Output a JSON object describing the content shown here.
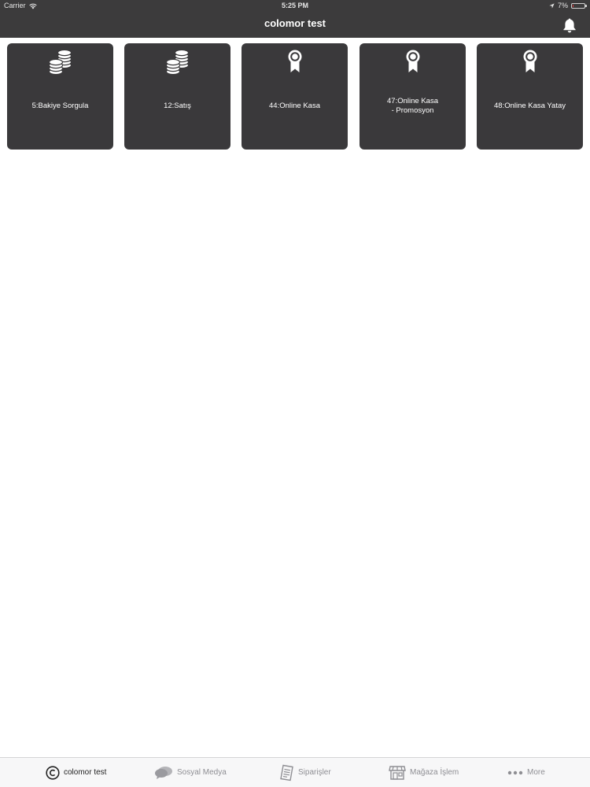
{
  "status_bar": {
    "carrier": "Carrier",
    "time": "5:25 PM",
    "battery_percent": "7%",
    "battery_level": 0.07
  },
  "nav": {
    "title": "colomor test",
    "notification_icon": "bell-icon"
  },
  "tiles": [
    {
      "label": "5:Bakiye Sorgula",
      "icon": "coins-icon"
    },
    {
      "label": "12:Satış",
      "icon": "coins-icon"
    },
    {
      "label": "44:Online Kasa",
      "icon": "award-ribbon-icon"
    },
    {
      "label": "47:Online Kasa\n- Promosyon",
      "icon": "award-ribbon-icon"
    },
    {
      "label": "48:Online Kasa Yatay",
      "icon": "award-ribbon-icon"
    }
  ],
  "tab_bar": {
    "items": [
      {
        "label": "colomor test",
        "icon": "copyright-icon",
        "active": true
      },
      {
        "label": "Sosyal Medya",
        "icon": "chat-bubbles-icon",
        "active": false
      },
      {
        "label": "Siparişler",
        "icon": "receipt-icon",
        "active": false
      },
      {
        "label": "Mağaza İşlem",
        "icon": "storefront-icon",
        "active": false
      },
      {
        "label": "More",
        "icon": "more-dots-icon",
        "active": false
      }
    ]
  },
  "colors": {
    "nav_background": "#3c3b3c",
    "tile_background": "#3a393b",
    "tab_active": "#222222",
    "tab_inactive": "#8e8e93",
    "battery_low": "#e03a3a"
  }
}
